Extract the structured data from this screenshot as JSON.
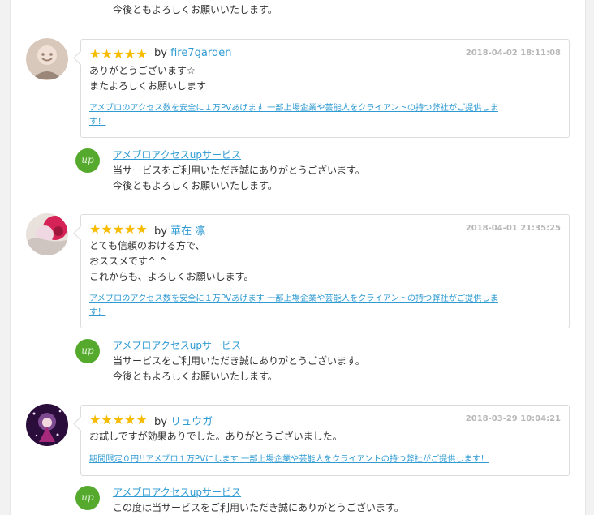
{
  "top_reply_tail": "今後ともよろしくお願いいたします。",
  "reviews": [
    {
      "stars": "★★★★★",
      "by_label": "by",
      "user": "fire7garden",
      "timestamp": "2018-04-02 18:11:08",
      "message": "ありがとうございます☆\nまたよろしくお願いします",
      "link_text": "アメブロのアクセス数を安全に１万PVあげます 一部上場企業や芸能人をクライアントの持つ弊社がご提供しま\nす！",
      "reply": {
        "icon_text": "up",
        "service": "アメブロアクセスupサービス",
        "text": "当サービスをご利用いただき誠にありがとうございます。\n今後ともよろしくお願いいたします。"
      }
    },
    {
      "stars": "★★★★★",
      "by_label": "by",
      "user": "華在 凛",
      "timestamp": "2018-04-01 21:35:25",
      "message": "とても信頼のおける方で、\nおススメです^ ^\nこれからも、よろしくお願いします。",
      "link_text": "アメブロのアクセス数を安全に１万PVあげます 一部上場企業や芸能人をクライアントの持つ弊社がご提供しま\nす！",
      "reply": {
        "icon_text": "up",
        "service": "アメブロアクセスupサービス",
        "text": "当サービスをご利用いただき誠にありがとうございます。\n今後ともよろしくお願いいたします。"
      }
    },
    {
      "stars": "★★★★★",
      "by_label": "by",
      "user": "リュウガ",
      "timestamp": "2018-03-29 10:04:21",
      "message": "お試しですが効果ありでした。ありがとうございました。",
      "link_text": "期間限定０円!!アメブロ１万PVにします 一部上場企業や芸能人をクライアントの持つ弊社がご提供します！",
      "reply": {
        "icon_text": "up",
        "service": "アメブロアクセスupサービス",
        "text": "この度は当サービスをご利用いただき誠にありがとうございます。"
      }
    }
  ]
}
